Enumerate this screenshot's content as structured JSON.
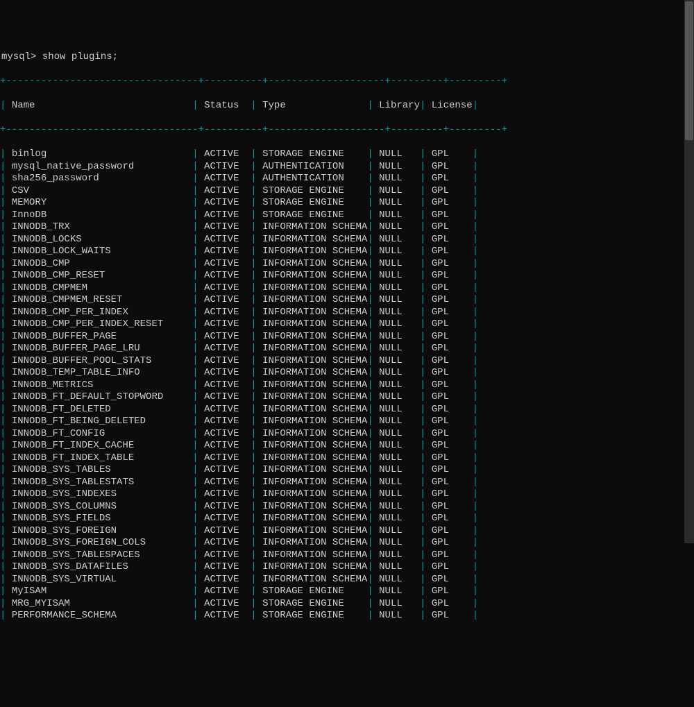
{
  "prompt": "mysql> show plugins;",
  "sep_top": "+---------------------------------+----------+--------------------+---------+---------+",
  "sep_header": "+---------------------------------+----------+--------------------+---------+---------+",
  "columns": {
    "name": "Name",
    "status": "Status",
    "type": "Type",
    "library": "Library",
    "license": "License"
  },
  "col_widths": {
    "name": 32,
    "status": 9,
    "type": 19,
    "library": 8,
    "license": 8
  },
  "rows": [
    {
      "name": "binlog",
      "status": "ACTIVE",
      "type": "STORAGE ENGINE",
      "library": "NULL",
      "license": "GPL"
    },
    {
      "name": "mysql_native_password",
      "status": "ACTIVE",
      "type": "AUTHENTICATION",
      "library": "NULL",
      "license": "GPL"
    },
    {
      "name": "sha256_password",
      "status": "ACTIVE",
      "type": "AUTHENTICATION",
      "library": "NULL",
      "license": "GPL"
    },
    {
      "name": "CSV",
      "status": "ACTIVE",
      "type": "STORAGE ENGINE",
      "library": "NULL",
      "license": "GPL"
    },
    {
      "name": "MEMORY",
      "status": "ACTIVE",
      "type": "STORAGE ENGINE",
      "library": "NULL",
      "license": "GPL"
    },
    {
      "name": "InnoDB",
      "status": "ACTIVE",
      "type": "STORAGE ENGINE",
      "library": "NULL",
      "license": "GPL"
    },
    {
      "name": "INNODB_TRX",
      "status": "ACTIVE",
      "type": "INFORMATION SCHEMA",
      "library": "NULL",
      "license": "GPL"
    },
    {
      "name": "INNODB_LOCKS",
      "status": "ACTIVE",
      "type": "INFORMATION SCHEMA",
      "library": "NULL",
      "license": "GPL"
    },
    {
      "name": "INNODB_LOCK_WAITS",
      "status": "ACTIVE",
      "type": "INFORMATION SCHEMA",
      "library": "NULL",
      "license": "GPL"
    },
    {
      "name": "INNODB_CMP",
      "status": "ACTIVE",
      "type": "INFORMATION SCHEMA",
      "library": "NULL",
      "license": "GPL"
    },
    {
      "name": "INNODB_CMP_RESET",
      "status": "ACTIVE",
      "type": "INFORMATION SCHEMA",
      "library": "NULL",
      "license": "GPL"
    },
    {
      "name": "INNODB_CMPMEM",
      "status": "ACTIVE",
      "type": "INFORMATION SCHEMA",
      "library": "NULL",
      "license": "GPL"
    },
    {
      "name": "INNODB_CMPMEM_RESET",
      "status": "ACTIVE",
      "type": "INFORMATION SCHEMA",
      "library": "NULL",
      "license": "GPL"
    },
    {
      "name": "INNODB_CMP_PER_INDEX",
      "status": "ACTIVE",
      "type": "INFORMATION SCHEMA",
      "library": "NULL",
      "license": "GPL"
    },
    {
      "name": "INNODB_CMP_PER_INDEX_RESET",
      "status": "ACTIVE",
      "type": "INFORMATION SCHEMA",
      "library": "NULL",
      "license": "GPL"
    },
    {
      "name": "INNODB_BUFFER_PAGE",
      "status": "ACTIVE",
      "type": "INFORMATION SCHEMA",
      "library": "NULL",
      "license": "GPL"
    },
    {
      "name": "INNODB_BUFFER_PAGE_LRU",
      "status": "ACTIVE",
      "type": "INFORMATION SCHEMA",
      "library": "NULL",
      "license": "GPL"
    },
    {
      "name": "INNODB_BUFFER_POOL_STATS",
      "status": "ACTIVE",
      "type": "INFORMATION SCHEMA",
      "library": "NULL",
      "license": "GPL"
    },
    {
      "name": "INNODB_TEMP_TABLE_INFO",
      "status": "ACTIVE",
      "type": "INFORMATION SCHEMA",
      "library": "NULL",
      "license": "GPL"
    },
    {
      "name": "INNODB_METRICS",
      "status": "ACTIVE",
      "type": "INFORMATION SCHEMA",
      "library": "NULL",
      "license": "GPL"
    },
    {
      "name": "INNODB_FT_DEFAULT_STOPWORD",
      "status": "ACTIVE",
      "type": "INFORMATION SCHEMA",
      "library": "NULL",
      "license": "GPL"
    },
    {
      "name": "INNODB_FT_DELETED",
      "status": "ACTIVE",
      "type": "INFORMATION SCHEMA",
      "library": "NULL",
      "license": "GPL"
    },
    {
      "name": "INNODB_FT_BEING_DELETED",
      "status": "ACTIVE",
      "type": "INFORMATION SCHEMA",
      "library": "NULL",
      "license": "GPL"
    },
    {
      "name": "INNODB_FT_CONFIG",
      "status": "ACTIVE",
      "type": "INFORMATION SCHEMA",
      "library": "NULL",
      "license": "GPL"
    },
    {
      "name": "INNODB_FT_INDEX_CACHE",
      "status": "ACTIVE",
      "type": "INFORMATION SCHEMA",
      "library": "NULL",
      "license": "GPL"
    },
    {
      "name": "INNODB_FT_INDEX_TABLE",
      "status": "ACTIVE",
      "type": "INFORMATION SCHEMA",
      "library": "NULL",
      "license": "GPL"
    },
    {
      "name": "INNODB_SYS_TABLES",
      "status": "ACTIVE",
      "type": "INFORMATION SCHEMA",
      "library": "NULL",
      "license": "GPL"
    },
    {
      "name": "INNODB_SYS_TABLESTATS",
      "status": "ACTIVE",
      "type": "INFORMATION SCHEMA",
      "library": "NULL",
      "license": "GPL"
    },
    {
      "name": "INNODB_SYS_INDEXES",
      "status": "ACTIVE",
      "type": "INFORMATION SCHEMA",
      "library": "NULL",
      "license": "GPL"
    },
    {
      "name": "INNODB_SYS_COLUMNS",
      "status": "ACTIVE",
      "type": "INFORMATION SCHEMA",
      "library": "NULL",
      "license": "GPL"
    },
    {
      "name": "INNODB_SYS_FIELDS",
      "status": "ACTIVE",
      "type": "INFORMATION SCHEMA",
      "library": "NULL",
      "license": "GPL"
    },
    {
      "name": "INNODB_SYS_FOREIGN",
      "status": "ACTIVE",
      "type": "INFORMATION SCHEMA",
      "library": "NULL",
      "license": "GPL"
    },
    {
      "name": "INNODB_SYS_FOREIGN_COLS",
      "status": "ACTIVE",
      "type": "INFORMATION SCHEMA",
      "library": "NULL",
      "license": "GPL"
    },
    {
      "name": "INNODB_SYS_TABLESPACES",
      "status": "ACTIVE",
      "type": "INFORMATION SCHEMA",
      "library": "NULL",
      "license": "GPL"
    },
    {
      "name": "INNODB_SYS_DATAFILES",
      "status": "ACTIVE",
      "type": "INFORMATION SCHEMA",
      "library": "NULL",
      "license": "GPL"
    },
    {
      "name": "INNODB_SYS_VIRTUAL",
      "status": "ACTIVE",
      "type": "INFORMATION SCHEMA",
      "library": "NULL",
      "license": "GPL"
    },
    {
      "name": "MyISAM",
      "status": "ACTIVE",
      "type": "STORAGE ENGINE",
      "library": "NULL",
      "license": "GPL"
    },
    {
      "name": "MRG_MYISAM",
      "status": "ACTIVE",
      "type": "STORAGE ENGINE",
      "library": "NULL",
      "license": "GPL"
    },
    {
      "name": "PERFORMANCE_SCHEMA",
      "status": "ACTIVE",
      "type": "STORAGE ENGINE",
      "library": "NULL",
      "license": "GPL"
    }
  ]
}
